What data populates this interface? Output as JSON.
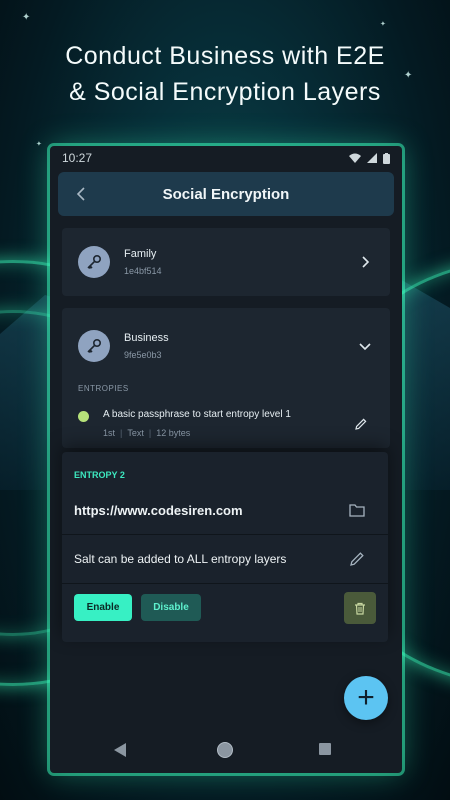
{
  "headline": {
    "line1": "Conduct Business with E2E",
    "line2": "& Social Encryption Layers"
  },
  "statusbar": {
    "time": "10:27"
  },
  "appbar": {
    "title": "Social Encryption"
  },
  "contacts": [
    {
      "name": "Family",
      "hash": "1e4bf514",
      "expanded": false
    },
    {
      "name": "Business",
      "hash": "9fe5e0b3",
      "expanded": true
    }
  ],
  "entropies": {
    "label": "ENTROPIES",
    "items": [
      {
        "title": "A basic passphrase to start entropy level 1",
        "order": "1st",
        "type": "Text",
        "size": "12 bytes",
        "dot_color": "#b6e27a"
      }
    ]
  },
  "entropy2": {
    "label": "ENTROPY 2",
    "url": "https://www.codesiren.com",
    "salt_text": "Salt can be added to ALL entropy layers",
    "enable_label": "Enable",
    "disable_label": "Disable"
  },
  "fab": {
    "label": "+"
  },
  "colors": {
    "accent": "#37f0c4",
    "fab": "#5cc4f2",
    "appbar": "#1e3a4c"
  }
}
